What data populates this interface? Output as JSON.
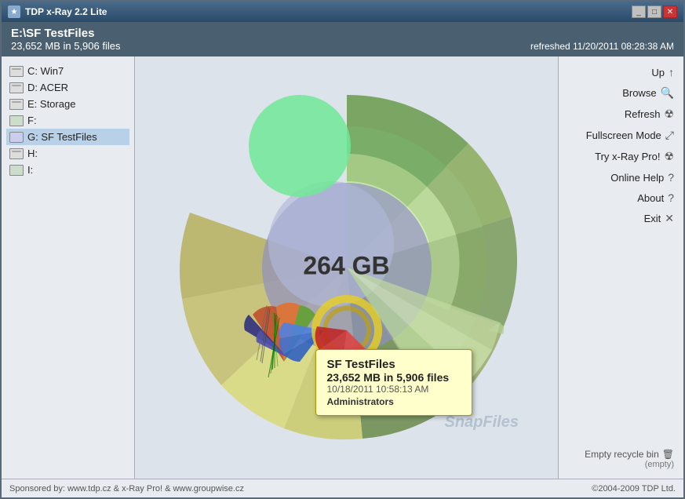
{
  "window": {
    "title": "TDP x-Ray 2.2 Lite",
    "controls": {
      "minimize": "_",
      "maximize": "□",
      "close": "✕"
    }
  },
  "header": {
    "path": "E:\\SF TestFiles",
    "info": "23,652 MB in 5,906 files",
    "refreshed": "refreshed 11/20/2011 08:28:38 AM"
  },
  "drives": [
    {
      "id": "c",
      "label": "C: Win7",
      "type": "hdd"
    },
    {
      "id": "d",
      "label": "D: ACER",
      "type": "hdd"
    },
    {
      "id": "e",
      "label": "E: Storage",
      "type": "hdd"
    },
    {
      "id": "f",
      "label": "F:",
      "type": "usb"
    },
    {
      "id": "g",
      "label": "G: SF TestFiles",
      "type": "optical",
      "selected": true
    },
    {
      "id": "h",
      "label": "H:",
      "type": "hdd"
    },
    {
      "id": "i",
      "label": "I:",
      "type": "usb"
    }
  ],
  "chart": {
    "center_label": "264 GB"
  },
  "nav_buttons": [
    {
      "id": "up",
      "label": "Up",
      "icon": "↑"
    },
    {
      "id": "browse",
      "label": "Browse",
      "icon": "🔍"
    },
    {
      "id": "refresh",
      "label": "Refresh",
      "icon": "☢"
    },
    {
      "id": "fullscreen",
      "label": "Fullscreen Mode",
      "icon": "✕"
    },
    {
      "id": "xray",
      "label": "Try x-Ray Pro!",
      "icon": "☢"
    },
    {
      "id": "help",
      "label": "Online Help",
      "icon": "?"
    },
    {
      "id": "about",
      "label": "About",
      "icon": "?"
    },
    {
      "id": "exit",
      "label": "Exit",
      "icon": "✕"
    }
  ],
  "recycle": {
    "label": "Empty recycle bin",
    "status": "(empty)"
  },
  "tooltip": {
    "title": "SF TestFiles",
    "size": "23,652 MB in 5,906 files",
    "date": "10/18/2011 10:58:13 AM",
    "user": "Administrators"
  },
  "watermark": "SnapFiles",
  "footer": {
    "left": "Sponsored by: www.tdp.cz & x-Ray Pro! & www.groupwise.cz",
    "right": "©2004-2009 TDP Ltd."
  }
}
